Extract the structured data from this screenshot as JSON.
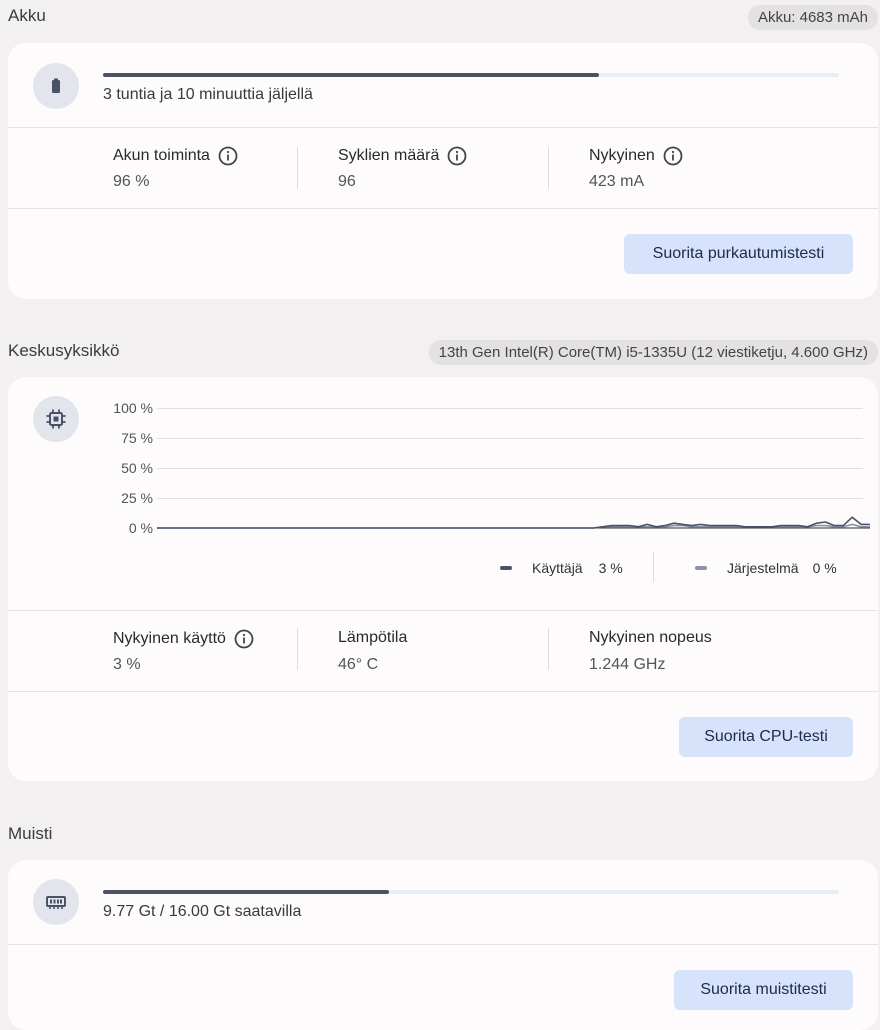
{
  "battery": {
    "title": "Akku",
    "capacity_pill": "Akku: 4683 mAh",
    "icon": "battery-icon",
    "charge_fraction": 0.674,
    "remaining_text": "3 tuntia ja 10 minuuttia jäljellä",
    "stats": [
      {
        "label": "Akun toiminta",
        "value": "96 %",
        "info": true
      },
      {
        "label": "Syklien määrä",
        "value": "96",
        "info": true
      },
      {
        "label": "Nykyinen",
        "value": "423 mA",
        "info": true
      }
    ],
    "button_label": "Suorita purkautumistesti"
  },
  "cpu": {
    "title": "Keskusyksikkö",
    "model_pill": "13th Gen Intel(R) Core(TM) i5-1335U (12 viestiketju, 4.600 GHz)",
    "icon": "cpu-chip-icon",
    "chart_data": {
      "type": "line",
      "yticks": [
        "100 %",
        "75 %",
        "50 %",
        "25 %",
        "0 %"
      ],
      "ylim": [
        0,
        100
      ],
      "series": [
        {
          "name": "Käyttäjä",
          "color": "#4a5366",
          "values": [
            0,
            0,
            0,
            0,
            0,
            0,
            0,
            0,
            0,
            0,
            0,
            0,
            0,
            0,
            0,
            0,
            0,
            0,
            0,
            0,
            0,
            0,
            0,
            0,
            0,
            0,
            0,
            0,
            0,
            0,
            0,
            0,
            0,
            0,
            0,
            0,
            0,
            0,
            0,
            0,
            0,
            0,
            0,
            0,
            0,
            0,
            0,
            0,
            0,
            0,
            1,
            2,
            2,
            2,
            1,
            3,
            1,
            2,
            4,
            3,
            2,
            3,
            2,
            2,
            2,
            2,
            1,
            1,
            1,
            1,
            2,
            2,
            2,
            1,
            4,
            5,
            2,
            2,
            9,
            3,
            3
          ]
        },
        {
          "name": "Järjestelmä",
          "color": "#8a93a8",
          "values": [
            0,
            0,
            0,
            0,
            0,
            0,
            0,
            0,
            0,
            0,
            0,
            0,
            0,
            0,
            0,
            0,
            0,
            0,
            0,
            0,
            0,
            0,
            0,
            0,
            0,
            0,
            0,
            0,
            0,
            0,
            0,
            0,
            0,
            0,
            0,
            0,
            0,
            0,
            0,
            0,
            0,
            0,
            0,
            0,
            0,
            0,
            0,
            0,
            0,
            0,
            1,
            1,
            1,
            1,
            1,
            1,
            1,
            1,
            2,
            2,
            1,
            1,
            1,
            1,
            1,
            1,
            1,
            1,
            1,
            1,
            1,
            1,
            1,
            1,
            2,
            2,
            1,
            1,
            3,
            1,
            1
          ]
        }
      ],
      "legend": [
        {
          "name": "Käyttäjä",
          "value": "3 %"
        },
        {
          "name": "Järjestelmä",
          "value": "0 %"
        }
      ]
    },
    "stats": [
      {
        "label": "Nykyinen käyttö",
        "value": "3 %",
        "info": true
      },
      {
        "label": "Lämpötila",
        "value": "46° C",
        "info": false
      },
      {
        "label": "Nykyinen nopeus",
        "value": "1.244 GHz",
        "info": false
      }
    ],
    "button_label": "Suorita CPU-testi"
  },
  "memory": {
    "title": "Muisti",
    "icon": "memory-chip-icon",
    "used_fraction": 0.389,
    "available_text": "9.77 Gt / 16.00 Gt saatavilla",
    "button_label": "Suorita muistitesti"
  }
}
